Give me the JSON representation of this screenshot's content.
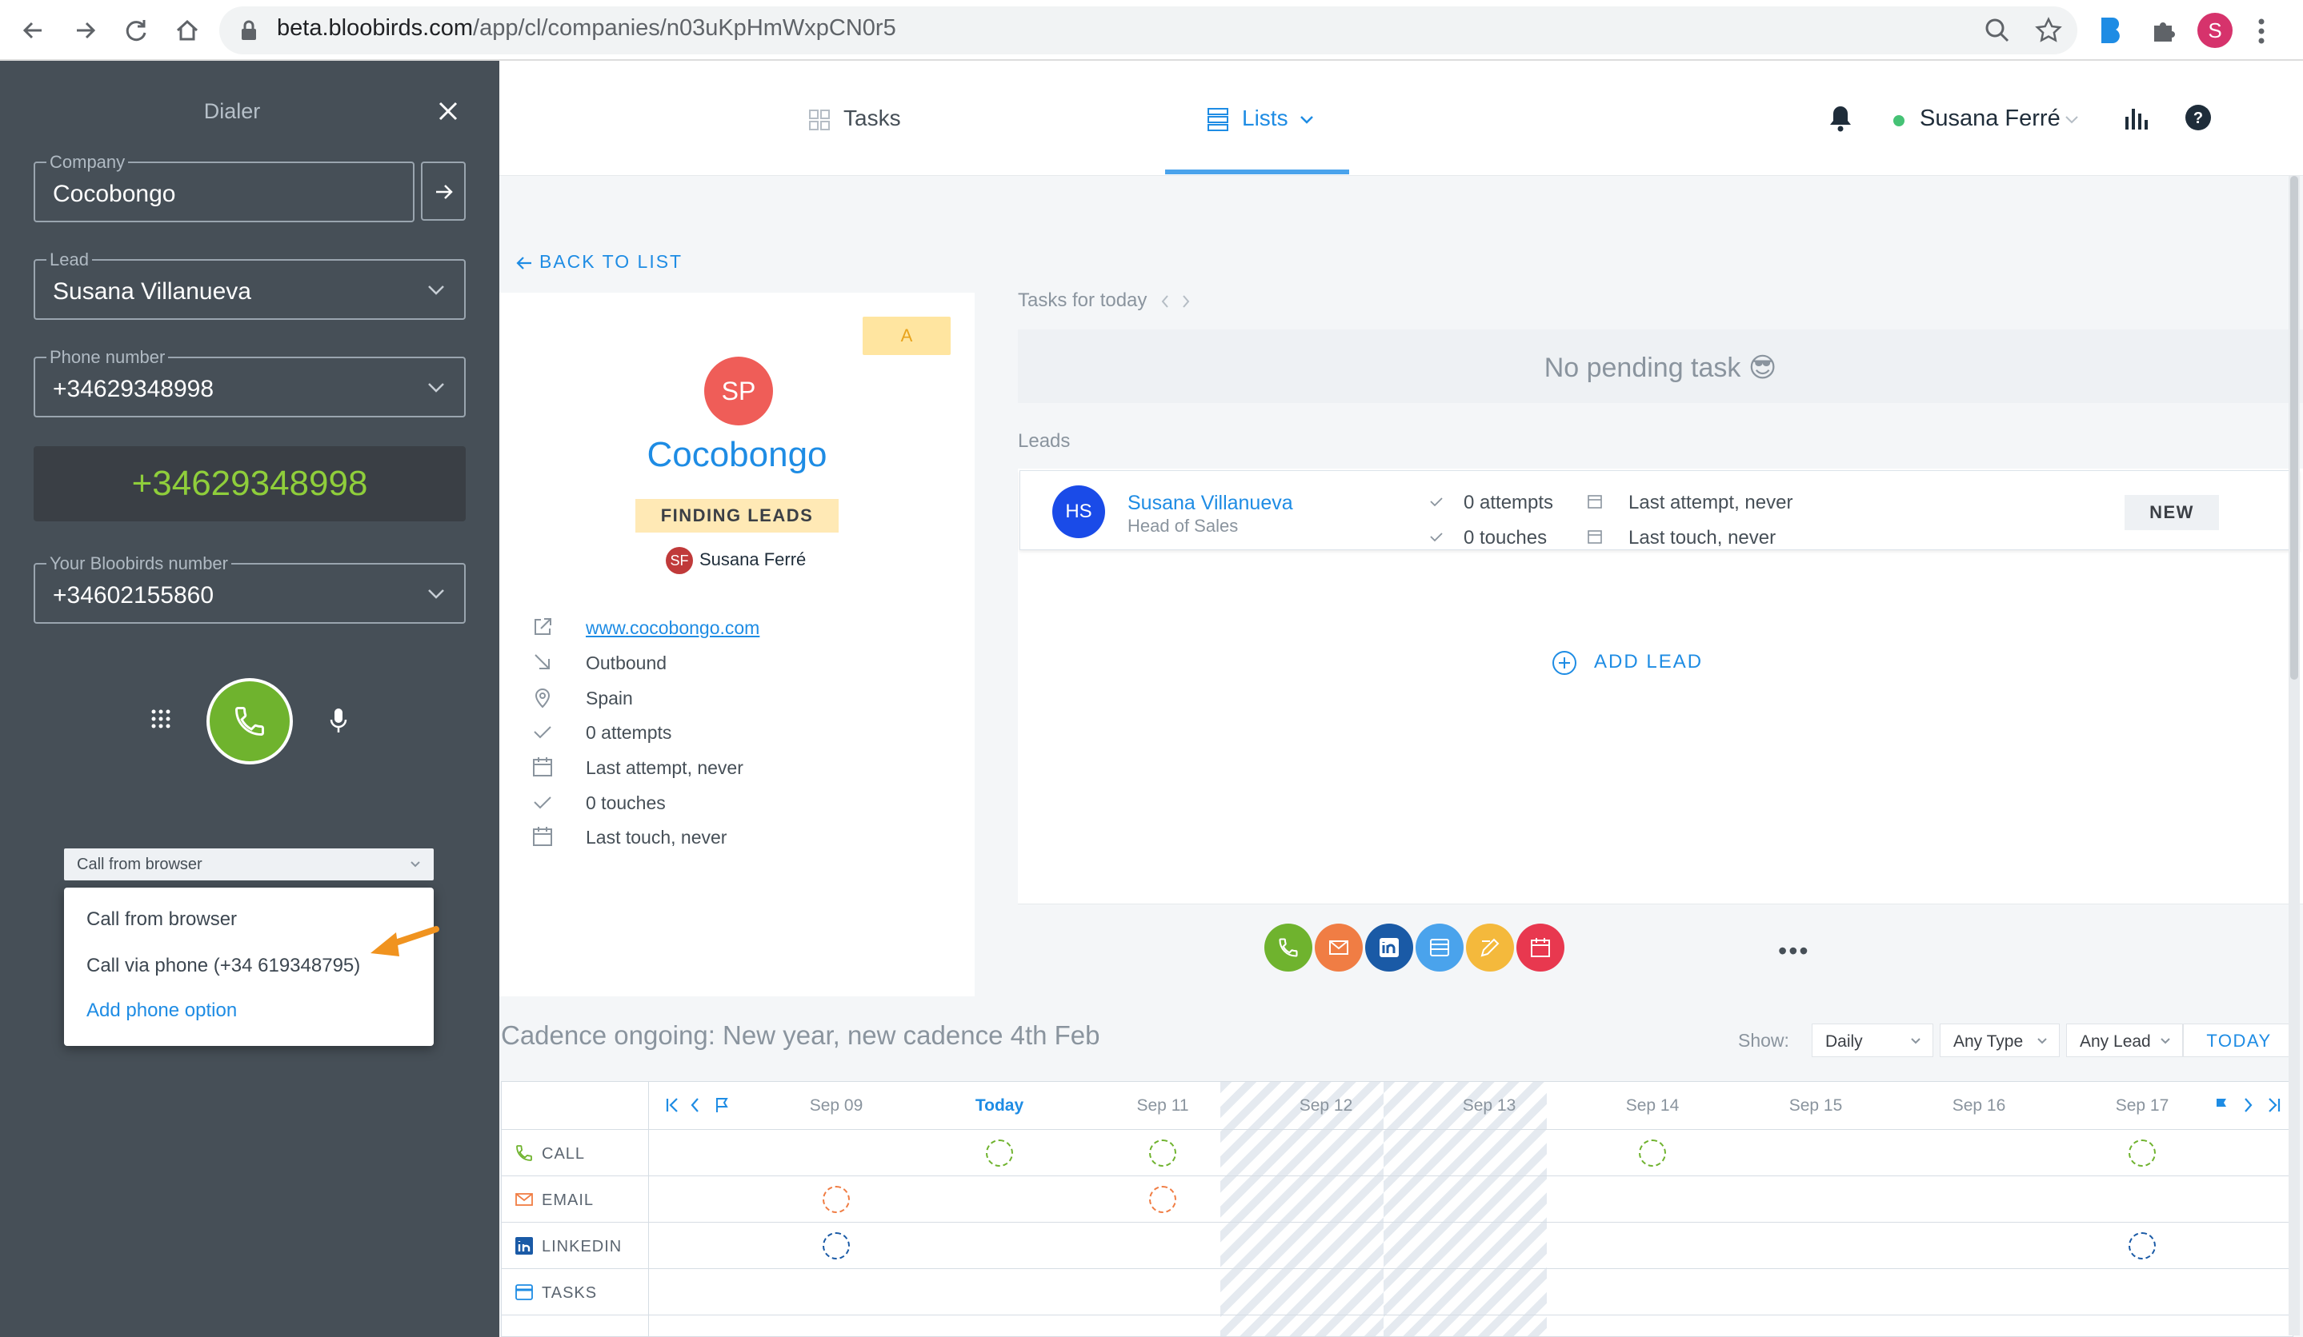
{
  "browser": {
    "url_host": "beta.bloobirds.com",
    "url_path": "/app/cl/companies/n03uKpHmWxpCN0r5",
    "profile_initial": "S"
  },
  "dialer": {
    "title": "Dialer",
    "company_label": "Company",
    "company_value": "Cocobongo",
    "lead_label": "Lead",
    "lead_value": "Susana Villanueva",
    "phone_label": "Phone number",
    "phone_value": "+34629348998",
    "display_number": "+34629348998",
    "bloobirds_label": "Your Bloobirds number",
    "bloobirds_value": "+34602155860",
    "call_mode_selected": "Call from browser",
    "call_mode_options": [
      "Call from browser",
      "Call via phone (+34 619348795)",
      "Add phone option"
    ]
  },
  "header": {
    "tabs": [
      "Tasks",
      "Lists"
    ],
    "active_tab": "Lists",
    "user_name": "Susana Ferré"
  },
  "back_label": "BACK TO LIST",
  "company": {
    "badge": "A",
    "initials": "SP",
    "name": "Cocobongo",
    "status": "FINDING LEADS",
    "owner_initials": "SF",
    "owner_name": "Susana Ferré",
    "info": [
      {
        "icon": "external-link-icon",
        "text": "www.cocobongo.com"
      },
      {
        "icon": "outbound-arrow-icon",
        "text": "Outbound"
      },
      {
        "icon": "location-pin-icon",
        "text": "Spain"
      },
      {
        "icon": "check-icon",
        "text": "0 attempts"
      },
      {
        "icon": "calendar-icon",
        "text": "Last attempt, never"
      },
      {
        "icon": "check-icon",
        "text": "0 touches"
      },
      {
        "icon": "calendar-icon",
        "text": "Last touch, never"
      }
    ]
  },
  "tasks_today": {
    "label": "Tasks for today",
    "empty_text": "No pending task 😎"
  },
  "leads": {
    "label": "Leads",
    "items": [
      {
        "initials": "HS",
        "name": "Susana Villanueva",
        "title": "Head of Sales",
        "attempts": "0 attempts",
        "touches": "0 touches",
        "last_attempt": "Last attempt, never",
        "last_touch": "Last touch, never",
        "badge": "NEW"
      }
    ],
    "add_label": "ADD LEAD"
  },
  "actions": [
    {
      "name": "call",
      "color": "#6fb32e"
    },
    {
      "name": "email",
      "color": "#f07d44"
    },
    {
      "name": "linkedin",
      "color": "#1a5aa6"
    },
    {
      "name": "meeting",
      "color": "#4aa3ec"
    },
    {
      "name": "note",
      "color": "#f4b93c"
    },
    {
      "name": "calendar",
      "color": "#e8384f"
    }
  ],
  "cadence": {
    "title": "Cadence ongoing: New year, new cadence 4th Feb",
    "show_label": "Show:",
    "filters": [
      "Daily",
      "Any Type",
      "Any Lead"
    ],
    "today_button": "TODAY",
    "days": [
      "Sep 09",
      "Today",
      "Sep 11",
      "Sep 12",
      "Sep 13",
      "Sep 14",
      "Sep 15",
      "Sep 16",
      "Sep 17"
    ],
    "rows": [
      "CALL",
      "EMAIL",
      "LINKEDIN",
      "TASKS"
    ]
  }
}
